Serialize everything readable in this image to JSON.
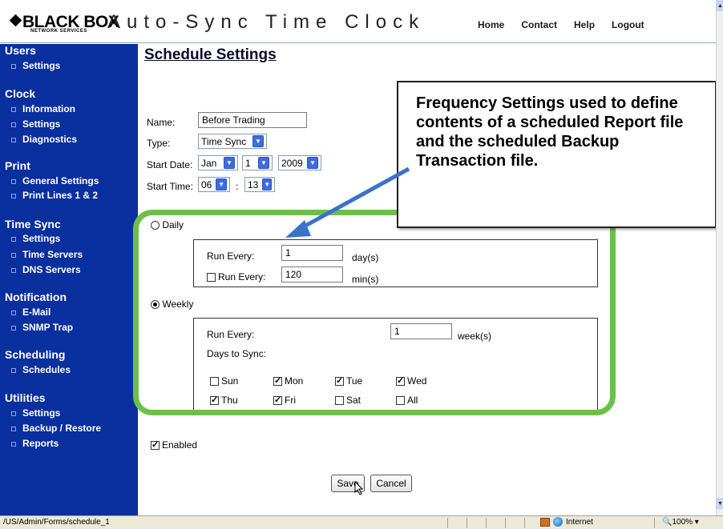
{
  "header": {
    "logo": "BLACK BOX",
    "logo_sub": "NETWORK SERVICES",
    "title": "Auto-Sync Time Clock",
    "nav": [
      "Home",
      "Contact",
      "Help",
      "Logout"
    ]
  },
  "sidebar": {
    "users": {
      "title": "Users",
      "items": [
        "Settings"
      ]
    },
    "clock": {
      "title": "Clock",
      "items": [
        "Information",
        "Settings",
        "Diagnostics"
      ]
    },
    "print": {
      "title": "Print",
      "items": [
        "General Settings",
        "Print Lines 1 & 2"
      ]
    },
    "timesync": {
      "title": "Time Sync",
      "items": [
        "Settings",
        "Time Servers",
        "DNS Servers"
      ]
    },
    "notification": {
      "title": "Notification",
      "items": [
        "E-Mail",
        "SNMP Trap"
      ]
    },
    "scheduling": {
      "title": "Scheduling",
      "items": [
        "Schedules"
      ]
    },
    "utilities": {
      "title": "Utilities",
      "items": [
        "Settings",
        "Backup / Restore",
        "Reports"
      ]
    }
  },
  "form": {
    "page_title": "Schedule Settings",
    "name_label": "Name:",
    "name_value": "Before Trading",
    "type_label": "Type:",
    "type_value": "Time Sync",
    "start_date_label": "Start Date:",
    "month": "Jan",
    "day": "1",
    "year": "2009",
    "start_time_label": "Start Time:",
    "hour": "06",
    "time_sep": ":",
    "minute": "13",
    "daily_label": "Daily",
    "daily_selected": false,
    "daily_run_every_label": "Run Every:",
    "daily_run_every_value": "1",
    "daily_unit": "day(s)",
    "min_checkbox_label": "Run Every:",
    "min_value": "120",
    "min_unit": "min(s)",
    "weekly_label": "Weekly",
    "weekly_selected": true,
    "weekly_run_every_label": "Run Every:",
    "weekly_run_every_value": "1",
    "weekly_unit": "week(s)",
    "days_to_sync_label": "Days to Sync:",
    "days": {
      "sun": "Sun",
      "mon": "Mon",
      "tue": "Tue",
      "wed": "Wed",
      "thu": "Thu",
      "fri": "Fri",
      "sat": "Sat",
      "all": "All"
    },
    "enabled_label": "Enabled",
    "save_label": "Save",
    "cancel_label": "Cancel"
  },
  "callout": {
    "text": "Frequency Settings used to define contents of a scheduled Report file and the scheduled Backup Transaction file."
  },
  "statusbar": {
    "url": "/US/Admin/Forms/schedule_1",
    "zone": "Internet",
    "zoom": "100%"
  },
  "colors": {
    "sidebar_bg": "#0a2f9e",
    "highlight_outline": "#6cc04a",
    "arrow": "#3a72c8"
  }
}
